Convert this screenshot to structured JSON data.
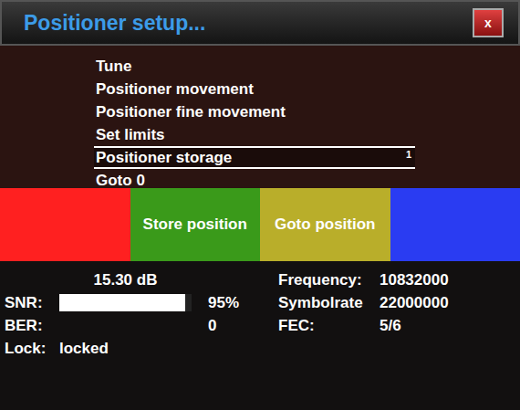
{
  "window": {
    "title": "Positioner setup...",
    "close": "x"
  },
  "menu": [
    {
      "label": "Tune",
      "selected": false
    },
    {
      "label": "Positioner movement",
      "selected": false
    },
    {
      "label": "Positioner fine movement",
      "selected": false
    },
    {
      "label": "Set limits",
      "selected": false
    },
    {
      "label": "Positioner storage",
      "selected": true,
      "value": "1"
    },
    {
      "label": "Goto 0",
      "selected": false
    }
  ],
  "color_buttons": [
    {
      "label": "",
      "color": "#ff2020"
    },
    {
      "label": "Store position",
      "color": "#3a9a1a"
    },
    {
      "label": "Goto position",
      "color": "#b9ae2a"
    },
    {
      "label": "",
      "color": "#2a3cf2"
    }
  ],
  "signal": {
    "snr_db": "15.30 dB",
    "snr_label": "SNR:",
    "snr_level": 0.95,
    "snr_percent": "95%",
    "ber_label": "BER:",
    "ber": "0",
    "lock_label": "Lock:",
    "lock": "locked"
  },
  "tuner": [
    {
      "label": "Frequency:",
      "value": "10832000"
    },
    {
      "label": "Symbolrate",
      "value": "22000000"
    },
    {
      "label": "FEC:",
      "value": "5/6"
    }
  ]
}
